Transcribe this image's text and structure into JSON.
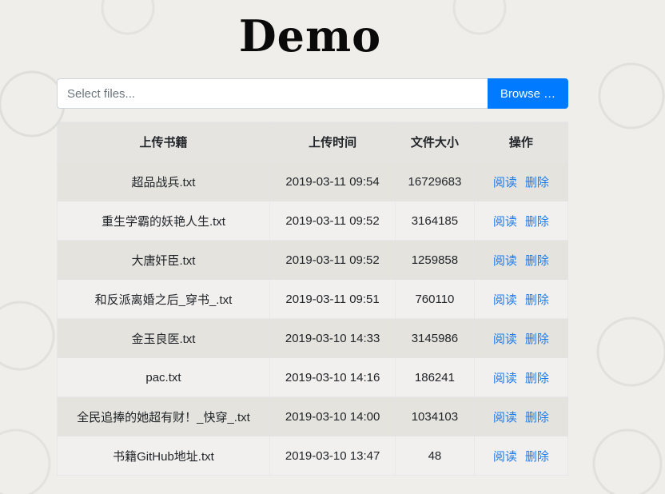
{
  "header": {
    "title": "Demo"
  },
  "file_picker": {
    "placeholder": "Select files...",
    "value": "",
    "browse_label": "Browse …"
  },
  "table": {
    "columns": [
      "上传书籍",
      "上传时间",
      "文件大小",
      "操作"
    ],
    "rows": [
      {
        "name": "超品战兵.txt",
        "time": "2019-03-11 09:54",
        "size": "16729683",
        "read": "阅读",
        "delete": "删除"
      },
      {
        "name": "重生学霸的妖艳人生.txt",
        "time": "2019-03-11 09:52",
        "size": "3164185",
        "read": "阅读",
        "delete": "删除"
      },
      {
        "name": "大唐奸臣.txt",
        "time": "2019-03-11 09:52",
        "size": "1259858",
        "read": "阅读",
        "delete": "删除"
      },
      {
        "name": "和反派离婚之后_穿书_.txt",
        "time": "2019-03-11 09:51",
        "size": "760110",
        "read": "阅读",
        "delete": "删除"
      },
      {
        "name": "金玉良医.txt",
        "time": "2019-03-10 14:33",
        "size": "3145986",
        "read": "阅读",
        "delete": "删除"
      },
      {
        "name": "pac.txt",
        "time": "2019-03-10 14:16",
        "size": "186241",
        "read": "阅读",
        "delete": "删除"
      },
      {
        "name": "全民追捧的她超有财！_快穿_.txt",
        "time": "2019-03-10 14:00",
        "size": "1034103",
        "read": "阅读",
        "delete": "删除"
      },
      {
        "name": "书籍GitHub地址.txt",
        "time": "2019-03-10 13:47",
        "size": "48",
        "read": "阅读",
        "delete": "删除"
      }
    ]
  },
  "colors": {
    "primary": "#007bff",
    "link": "#1a7cf0",
    "text": "#212529"
  }
}
